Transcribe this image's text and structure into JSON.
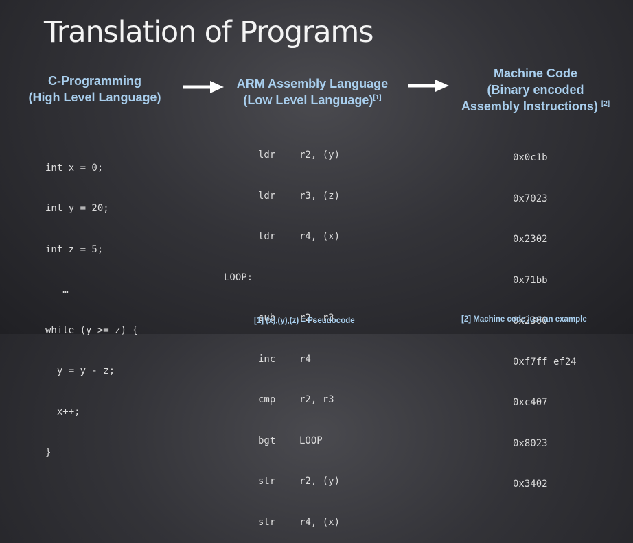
{
  "title": "Translation of Programs",
  "columns": {
    "c": {
      "line1": "C-Programming",
      "line2": "(High Level Language)"
    },
    "arm": {
      "line1": "ARM Assembly Language",
      "line2": "(Low Level Language)",
      "ref": "[1]"
    },
    "mc": {
      "line1": "Machine Code",
      "line2": "(Binary encoded",
      "line3": "Assembly Instructions)",
      "ref": "[2]"
    }
  },
  "c_code": [
    "int x = 0;",
    "int y = 20;",
    "int z = 5;",
    "   …",
    "while (y >= z) {",
    "  y = y - z;",
    "  x++;",
    "}"
  ],
  "arm_code": [
    {
      "label": "",
      "op": "ldr",
      "args": "r2, (y)"
    },
    {
      "label": "",
      "op": "ldr",
      "args": "r3, (z)"
    },
    {
      "label": "",
      "op": "ldr",
      "args": "r4, (x)"
    },
    {
      "label": "LOOP:",
      "op": "",
      "args": ""
    },
    {
      "label": "",
      "op": "sub",
      "args": "r2, r3"
    },
    {
      "label": "",
      "op": "inc",
      "args": "r4"
    },
    {
      "label": "",
      "op": "cmp",
      "args": "r2, r3"
    },
    {
      "label": "",
      "op": "bgt",
      "args": "LOOP"
    },
    {
      "label": "",
      "op": "str",
      "args": "r2, (y)"
    },
    {
      "label": "",
      "op": "str",
      "args": "r4, (x)"
    }
  ],
  "machine_code": [
    "0x0c1b",
    "0x7023",
    "0x2302",
    "0x71bb",
    "0x2300",
    "0xf7ff ef24",
    "0xc407",
    "0x8023",
    "0x3402"
  ],
  "footnotes": {
    "fn1": "[1] (x),(y),(z) = Pseudocode",
    "fn2": "[2] Machine code just an example"
  },
  "colors": {
    "heading": "#a9cfee",
    "background": "#333338",
    "text": "#dcdcdc"
  }
}
